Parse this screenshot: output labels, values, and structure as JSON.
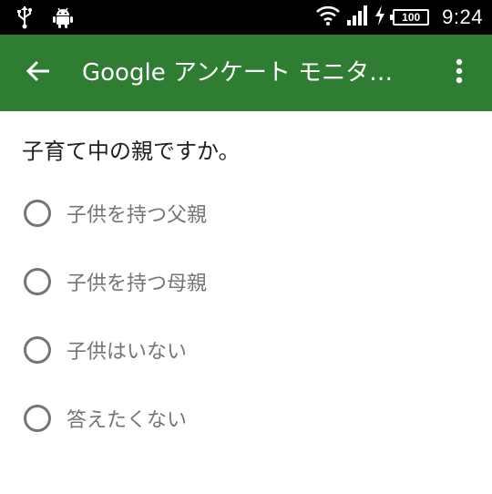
{
  "status_bar": {
    "time": "9:24",
    "battery_level": "100",
    "icons": [
      "usb-icon",
      "android-icon",
      "wifi-icon",
      "signal-icon",
      "charging-icon",
      "battery-icon"
    ]
  },
  "app_bar": {
    "title": "Google アンケート モニタ…",
    "back_icon": "arrow-back-icon",
    "menu_icon": "more-vert-icon",
    "color": "#2e7d32"
  },
  "survey": {
    "question": "子育て中の親ですか。",
    "options": [
      {
        "label": "子供を持つ父親",
        "selected": false
      },
      {
        "label": "子供を持つ母親",
        "selected": false
      },
      {
        "label": "子供はいない",
        "selected": false
      },
      {
        "label": "答えたくない",
        "selected": false
      }
    ]
  }
}
